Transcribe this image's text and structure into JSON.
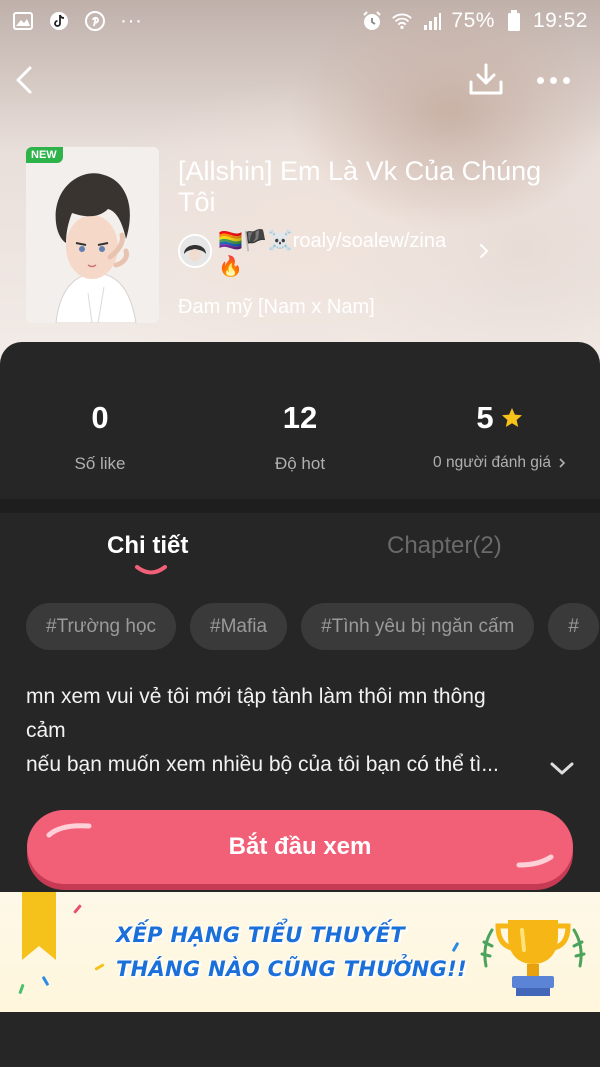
{
  "status_bar": {
    "battery_percent": "75%",
    "time": "19:52",
    "more_dots": "···"
  },
  "nav": {
    "back_icon": "chevron-left-icon",
    "download_icon": "download-icon",
    "more_icon": "more-icon"
  },
  "story": {
    "badge": "NEW",
    "title": "[Allshin] Em Là Vk Của Chúng Tôi",
    "author": "🏳️‍🌈🏴☠️roaly/soalew/zina🔥",
    "genre": "Đam mỹ [Nam x Nam]"
  },
  "stats": {
    "likes": {
      "value": "0",
      "label": "Số like"
    },
    "hot": {
      "value": "12",
      "label": "Độ hot"
    },
    "rating": {
      "value": "5",
      "label": "0 người đánh giá"
    }
  },
  "tabs": [
    {
      "label": "Chi tiết",
      "active": true
    },
    {
      "label": "Chapter(2)",
      "active": false
    }
  ],
  "tags": [
    "#Trường học",
    "#Mafia",
    "#Tình yêu bị ngăn cấm",
    "#"
  ],
  "description": {
    "line1": "mn xem vui vẻ tôi mới tập tành làm thôi mn thông",
    "line2": "cảm",
    "line3": "nếu bạn muốn xem nhiều bộ của tôi bạn có thể tì..."
  },
  "start_button": "Bắt đầu xem",
  "banner": {
    "line1": "XẾP HẠNG TIỂU THUYẾT",
    "line2": "THÁNG NÀO CŨNG THƯỞNG!!"
  },
  "colors": {
    "accent_pink": "#f26078",
    "star": "#f7c31a",
    "banner_text": "#1b6fd9",
    "panel_bg": "#262626"
  }
}
